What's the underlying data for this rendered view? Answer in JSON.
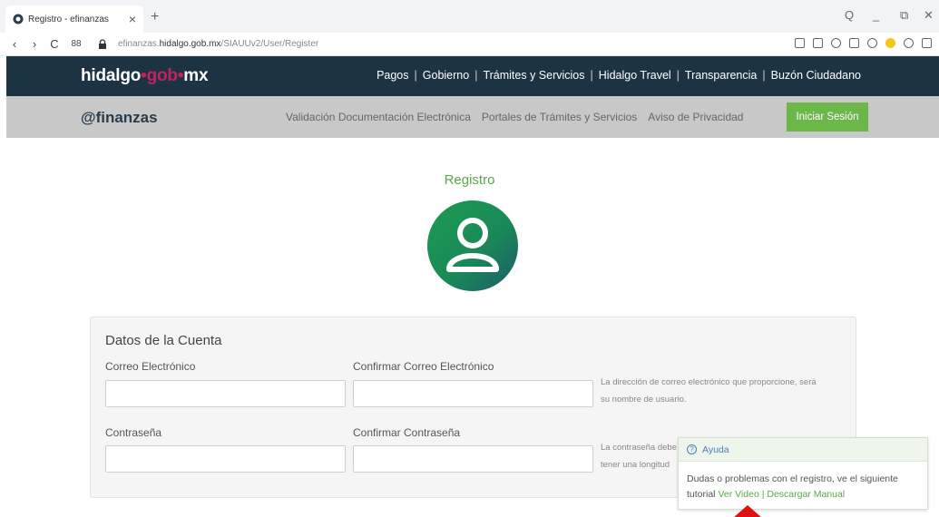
{
  "browser": {
    "tab_title": "Registro - efinanzas",
    "tab_close": "×",
    "new_tab": "+",
    "url_prefix": "efinanzas.",
    "url_domain": "hidalgo.gob.mx",
    "url_path": "/SIAUUv2/User/Register",
    "nav": {
      "back": "‹",
      "forward": "›",
      "reload": "C",
      "grid": "88"
    },
    "window": {
      "search": "Q",
      "minimize": "_",
      "restore": "⧉",
      "close": "✕"
    }
  },
  "header": {
    "brand_part1": "hidalgo",
    "brand_dot1": "•",
    "brand_part2": "gob",
    "brand_dot2": "•",
    "brand_part3": "mx",
    "menu": [
      "Pagos",
      "Gobierno",
      "Trámites y Servicios",
      "Hidalgo Travel",
      "Transparencia",
      "Buzón Ciudadano"
    ],
    "separator": "|"
  },
  "subheader": {
    "logo": "@finanzas",
    "menu": [
      "Validación Documentación Electrónica",
      "Portales de Trámites y Servicios",
      "Aviso de Privacidad"
    ],
    "login_label": "Iniciar Sesión"
  },
  "main": {
    "title": "Registro"
  },
  "form": {
    "title": "Datos de la Cuenta",
    "email_label": "Correo Electrónico",
    "email_confirm_label": "Confirmar Correo Electrónico",
    "email_hint_line1": "La dirección de correo electrónico que proporcione, será",
    "email_hint_line2": "su nombre de usuario.",
    "password_label": "Contraseña",
    "password_confirm_label": "Confirmar Contraseña",
    "password_hint_line1": "La contraseña debe",
    "password_hint_line2": "tener una longitud",
    "email_value": "",
    "email_confirm_value": "",
    "password_value": "",
    "password_confirm_value": ""
  },
  "help": {
    "title": "Ayuda",
    "text": "Dudas o problemas con el registro, ve el siguiente tutorial",
    "video_link": "Ver Video",
    "sep": "|",
    "manual_link": "Descargar Manual"
  },
  "colors": {
    "topnav": "#1c3344",
    "subnav": "#c8c8c8",
    "accent_green": "#6cb74a",
    "brand_pink": "#c4215f",
    "pointer_red": "#e01010"
  }
}
